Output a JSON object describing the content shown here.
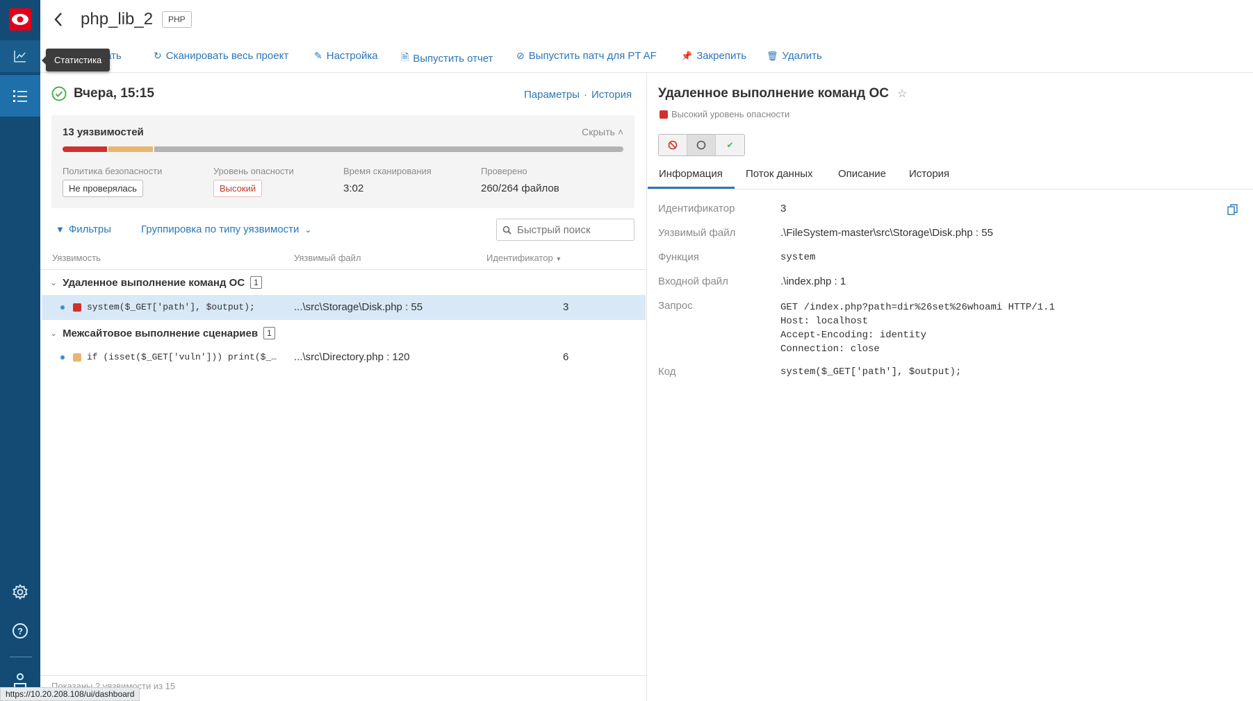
{
  "sidebar": {
    "tooltip": "Статистика"
  },
  "header": {
    "title": "php_lib_2",
    "lang_badge": "PHP"
  },
  "toolbar": {
    "items": [
      {
        "label": "ать",
        "icon": "hidden-icon"
      },
      {
        "label": "Сканировать весь проект",
        "icon": "scan-icon"
      },
      {
        "label": "Настройка",
        "icon": "pencil-icon"
      },
      {
        "label": "Выпустить отчет",
        "icon": "document-icon"
      },
      {
        "label": "Выпустить патч для PT AF",
        "icon": "patch-icon"
      },
      {
        "label": "Закрепить",
        "icon": "pin-icon"
      },
      {
        "label": "Удалить",
        "icon": "trash-icon"
      }
    ]
  },
  "scan": {
    "title": "Вчера, 15:15",
    "params_link": "Параметры",
    "sep": "·",
    "history_link": "История"
  },
  "summary": {
    "count_label": "13 уязвимостей",
    "hide": "Скрыть",
    "bar": {
      "high": 8,
      "medium": 8,
      "other": 84
    },
    "colors": {
      "high": "#d0312d",
      "medium": "#e8b66e",
      "other": "#b3b3b3"
    },
    "fields": [
      {
        "label": "Политика безопасности",
        "value": "Не проверялась"
      },
      {
        "label": "Уровень опасности",
        "value": "Высокий"
      },
      {
        "label": "Время сканирования",
        "value": "3:02"
      },
      {
        "label": "Проверено",
        "value": "260/264 файлов"
      }
    ]
  },
  "filters": {
    "filters_label": "Фильтры",
    "grouping": "Группировка по типу уязвимости",
    "search_placeholder": "Быстрый поиск"
  },
  "table": {
    "columns": [
      "Уязвимость",
      "Уязвимый файл",
      "Идентификатор"
    ],
    "groups": [
      {
        "name": "Удаленное выполнение команд ОС",
        "count": "1",
        "rows": [
          {
            "code": "system($_GET['path'], $output);",
            "file": "...\\src\\Storage\\Disk.php : 55",
            "id": "3",
            "severity_color": "#d0312d",
            "selected": true
          }
        ]
      },
      {
        "name": "Межсайтовое выполнение сценариев",
        "count": "1",
        "rows": [
          {
            "code": "if (isset($_GET['vuln'])) print($_…",
            "file": "...\\src\\Directory.php : 120",
            "id": "6",
            "severity_color": "#e8b66e",
            "selected": false
          }
        ]
      }
    ]
  },
  "footer": {
    "shown": "Показаны 2 уязвимости из 15"
  },
  "statusbar": {
    "url": "https://10.20.208.108/ui/dashboard"
  },
  "detail": {
    "title": "Удаленное выполнение команд ОС",
    "severity": "Высокий уровень опасности",
    "tabs": [
      "Информация",
      "Поток данных",
      "Описание",
      "История"
    ],
    "active_tab": "Информация",
    "info": [
      {
        "label": "Идентификатор",
        "value": "3"
      },
      {
        "label": "Уязвимый файл",
        "value": ".\\FileSystem-master\\src\\Storage\\Disk.php : 55"
      },
      {
        "label": "Функция",
        "value": "system"
      },
      {
        "label": "Входной файл",
        "value": ".\\index.php : 1"
      },
      {
        "label": "Запрос",
        "lines": [
          "GET /index.php?path=dir%26set%26whoami HTTP/1.1",
          "Host: localhost",
          "Accept-Encoding: identity",
          "Connection: close"
        ]
      },
      {
        "label": "Код",
        "value": "system($_GET['path'], $output);"
      }
    ]
  }
}
